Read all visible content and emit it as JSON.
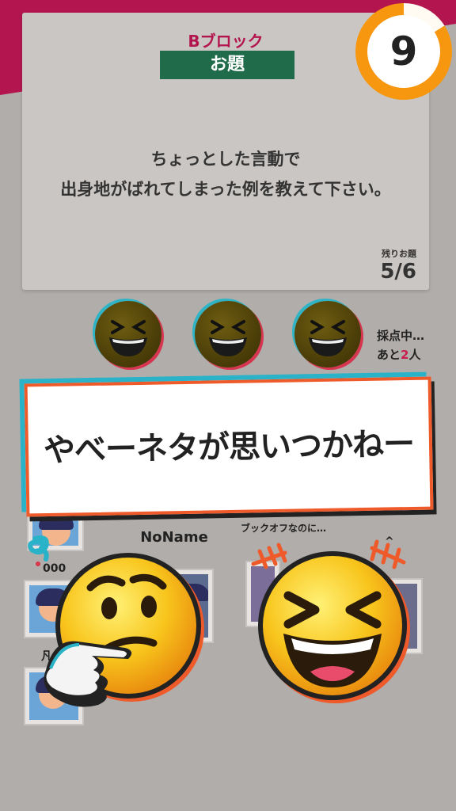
{
  "prompt": {
    "block": "Bブロック",
    "topic_label": "お題",
    "question_line1": "ちょっとした言動で",
    "question_line2": "出身地がばれてしまった例を教えて下さい。",
    "remaining_label": "残りお題",
    "remaining_value": "5/6"
  },
  "timer": {
    "value": "9"
  },
  "scoring": {
    "line1": "採点中…",
    "line2_prefix": "あと",
    "line2_count": "2",
    "line2_suffix": "人"
  },
  "banner": {
    "text": "やべーネタが思いつかねー"
  },
  "players": {
    "center_name": "NoName",
    "right_comment": "ブックオフなのに…",
    "right_partial": "^",
    "left_partial_1": "000",
    "left_partial_2": "凡"
  },
  "icons": {
    "judge_faces": [
      "laughing-face-icon",
      "laughing-face-icon",
      "laughing-face-icon"
    ],
    "big_left": "thinking-face-icon",
    "big_right": "grinning-squint-face-icon"
  },
  "colors": {
    "accent": "#b3154e",
    "topic_green": "#1f6b4a",
    "timer_orange": "#f7960f",
    "banner_border": "#ef5a2a",
    "banner_shadow": "#2ab3c8"
  }
}
